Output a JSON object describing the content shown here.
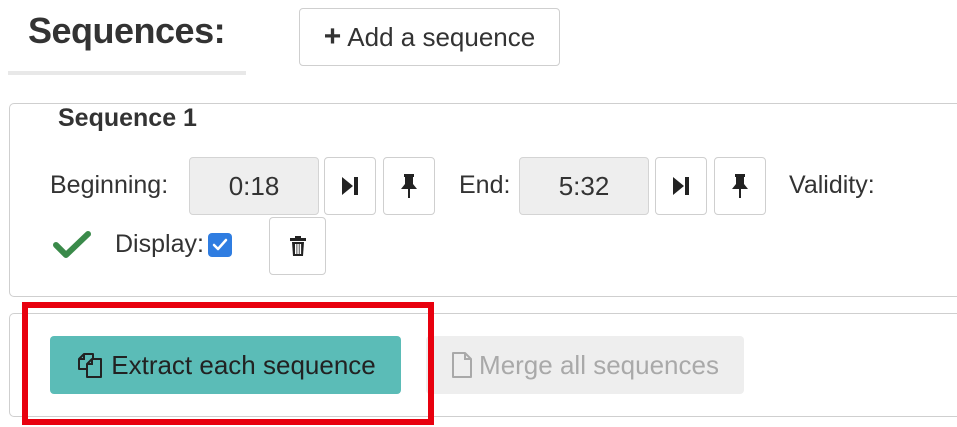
{
  "header": {
    "title": "Sequences:",
    "add_label": "Add a sequence"
  },
  "sequence": {
    "legend": "Sequence 1",
    "beginning_label": "Beginning:",
    "beginning_value": "0:18",
    "end_label": "End:",
    "end_value": "5:32",
    "validity_label": "Validity:",
    "display_label": "Display:",
    "display_checked": true
  },
  "actions": {
    "extract_label": "Extract each sequence",
    "merge_label": "Merge all sequences"
  },
  "colors": {
    "extract_bg": "#5bbcb7",
    "valid_check": "#3a8a4a",
    "highlight": "#e8000e",
    "checkbox": "#2f7de1"
  },
  "icons": {
    "add": "plus-icon",
    "go_to": "step-forward-icon",
    "set": "pin-icon",
    "valid": "checkmark-icon",
    "delete": "trash-icon",
    "extract": "copy-icon",
    "merge": "file-icon"
  }
}
